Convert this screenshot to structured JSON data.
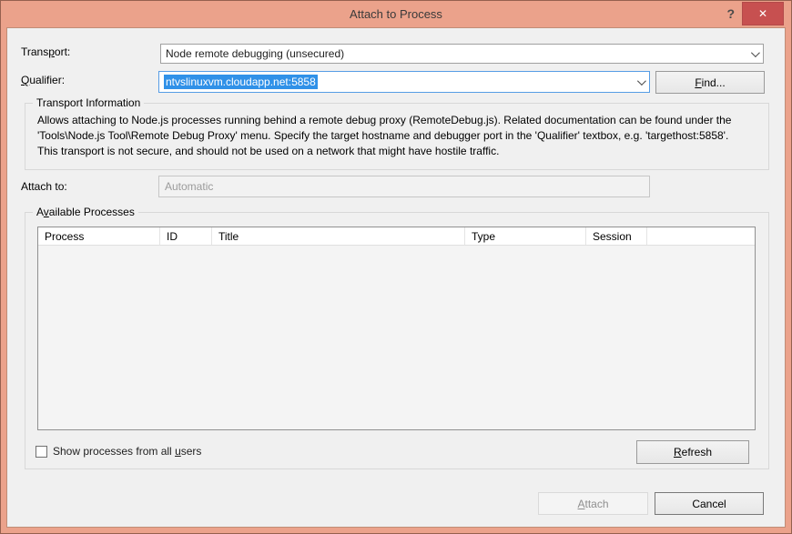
{
  "window": {
    "title": "Attach to Process",
    "help_glyph": "?",
    "close_glyph": "✕"
  },
  "colors": {
    "titlebar_bg": "#eba28b",
    "close_button_bg": "#c75050",
    "selection_bg": "#3091e8",
    "focus_border": "#569de5",
    "client_bg": "#f0f0f0"
  },
  "form": {
    "transport_label": {
      "pre": "Trans",
      "key": "p",
      "post": "ort:"
    },
    "transport_value": "Node remote debugging (unsecured)",
    "qualifier_label": {
      "pre": "",
      "key": "Q",
      "post": "ualifier:"
    },
    "qualifier_value": "ntvslinuxvm.cloudapp.net:5858",
    "find_button": {
      "pre": "",
      "key": "F",
      "post": "ind..."
    },
    "attach_to_label": "Attach to:",
    "attach_to_value": "Automatic"
  },
  "transport_info": {
    "title": "Transport Information",
    "lines": [
      "Allows attaching to Node.js processes running behind a remote debug proxy (RemoteDebug.js). Related documentation can be found under the",
      "'Tools\\Node.js Tool\\Remote Debug Proxy' menu. Specify the target hostname and debugger port in the 'Qualifier' textbox, e.g. 'targethost:5858'.",
      "This transport is not secure, and should not be used on a network that might have hostile traffic."
    ]
  },
  "processes": {
    "title": {
      "pre": "A",
      "key": "v",
      "post": "ailable Processes"
    },
    "columns": [
      "Process",
      "ID",
      "Title",
      "Type",
      "Session",
      ""
    ],
    "rows": []
  },
  "footer": {
    "show_all_users": {
      "pre": "Show processes from all ",
      "key": "u",
      "post": "sers"
    },
    "refresh_button": {
      "pre": "",
      "key": "R",
      "post": "efresh"
    },
    "attach_button": {
      "pre": "",
      "key": "A",
      "post": "ttach"
    },
    "cancel_button": "Cancel"
  }
}
